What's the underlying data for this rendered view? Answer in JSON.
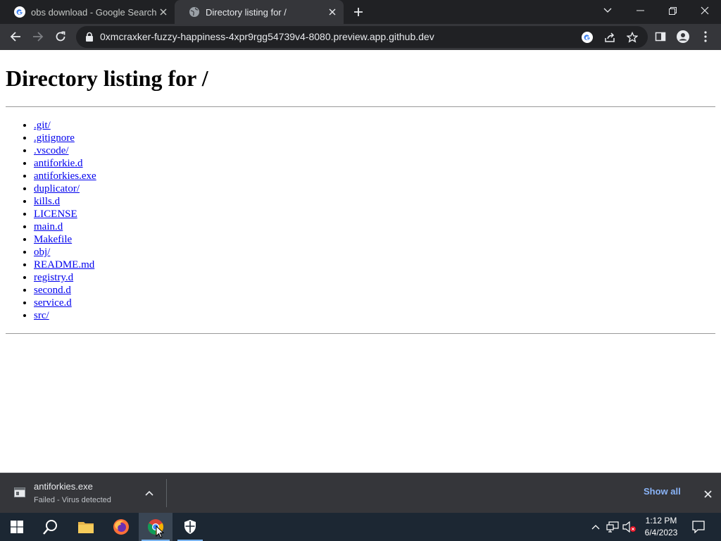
{
  "browser": {
    "tabs": [
      {
        "title": "obs download - Google Search",
        "favicon": "google-icon",
        "active": false
      },
      {
        "title": "Directory listing for /",
        "favicon": "globe-icon",
        "active": true
      }
    ],
    "address": {
      "url": "0xmcraxker-fuzzy-happiness-4xpr9rgg54739v4-8080.preview.app.github.dev"
    }
  },
  "page": {
    "heading": "Directory listing for /",
    "entries": [
      ".git/",
      ".gitignore",
      ".vscode/",
      "antiforkie.d",
      "antiforkies.exe",
      "duplicator/",
      "kills.d",
      "LICENSE",
      "main.d",
      "Makefile",
      "obj/",
      "README.md",
      "registry.d",
      "second.d",
      "service.d",
      "src/"
    ]
  },
  "downloads": {
    "file_name": "antiforkies.exe",
    "status": "Failed - Virus detected",
    "show_all_label": "Show all"
  },
  "taskbar": {
    "time": "1:12 PM",
    "date": "6/4/2023"
  },
  "colors": {
    "link": "#0000ee",
    "show_all": "#8ab4f8",
    "tabstrip": "#202124",
    "toolbar": "#35363a"
  }
}
